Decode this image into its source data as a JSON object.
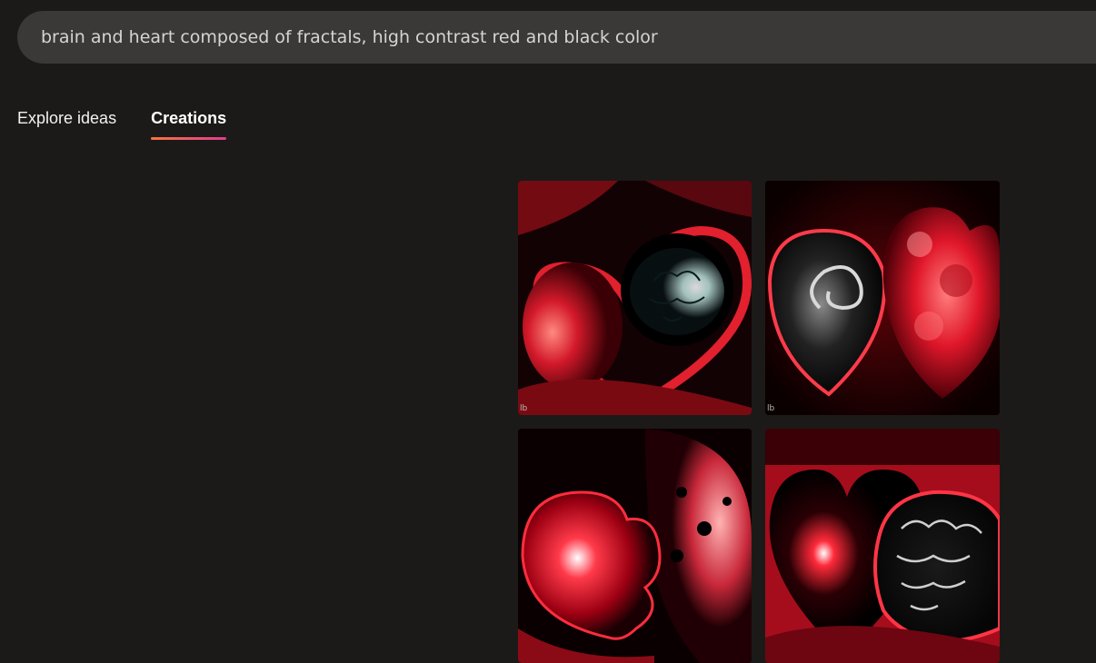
{
  "prompt": {
    "text": "brain and heart composed of fractals, high contrast red and black color"
  },
  "tabs": [
    {
      "label": "Explore ideas",
      "active": false
    },
    {
      "label": "Creations",
      "active": true
    }
  ],
  "accent": {
    "tab_underline_start": "#f7743f",
    "tab_underline_end": "#e03d8f"
  },
  "results": {
    "watermark": "lb",
    "images": [
      {
        "name": "creation-1"
      },
      {
        "name": "creation-2"
      },
      {
        "name": "creation-3"
      },
      {
        "name": "creation-4"
      }
    ]
  }
}
